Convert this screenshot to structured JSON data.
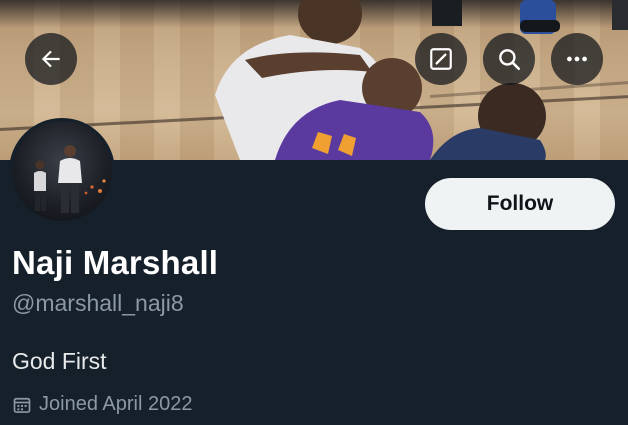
{
  "banner": {
    "image_description": "basketball",
    "actions": [
      {
        "name": "back",
        "icon": "arrow-left-icon"
      },
      {
        "name": "edit",
        "icon": "compose-icon"
      },
      {
        "name": "search",
        "icon": "search-icon"
      },
      {
        "name": "more",
        "icon": "more-horizontal-icon"
      }
    ]
  },
  "profile": {
    "display_name": "Naji Marshall",
    "handle": "@marshall_naji8",
    "bio": "God First",
    "joined": "Joined April 2022",
    "follow_label": "Follow"
  },
  "colors": {
    "background": "#15202b",
    "follow_button_bg": "#eff3f4",
    "follow_button_text": "#0f1419",
    "secondary_text": "#8b98a5",
    "primary_text": "#ffffff"
  }
}
